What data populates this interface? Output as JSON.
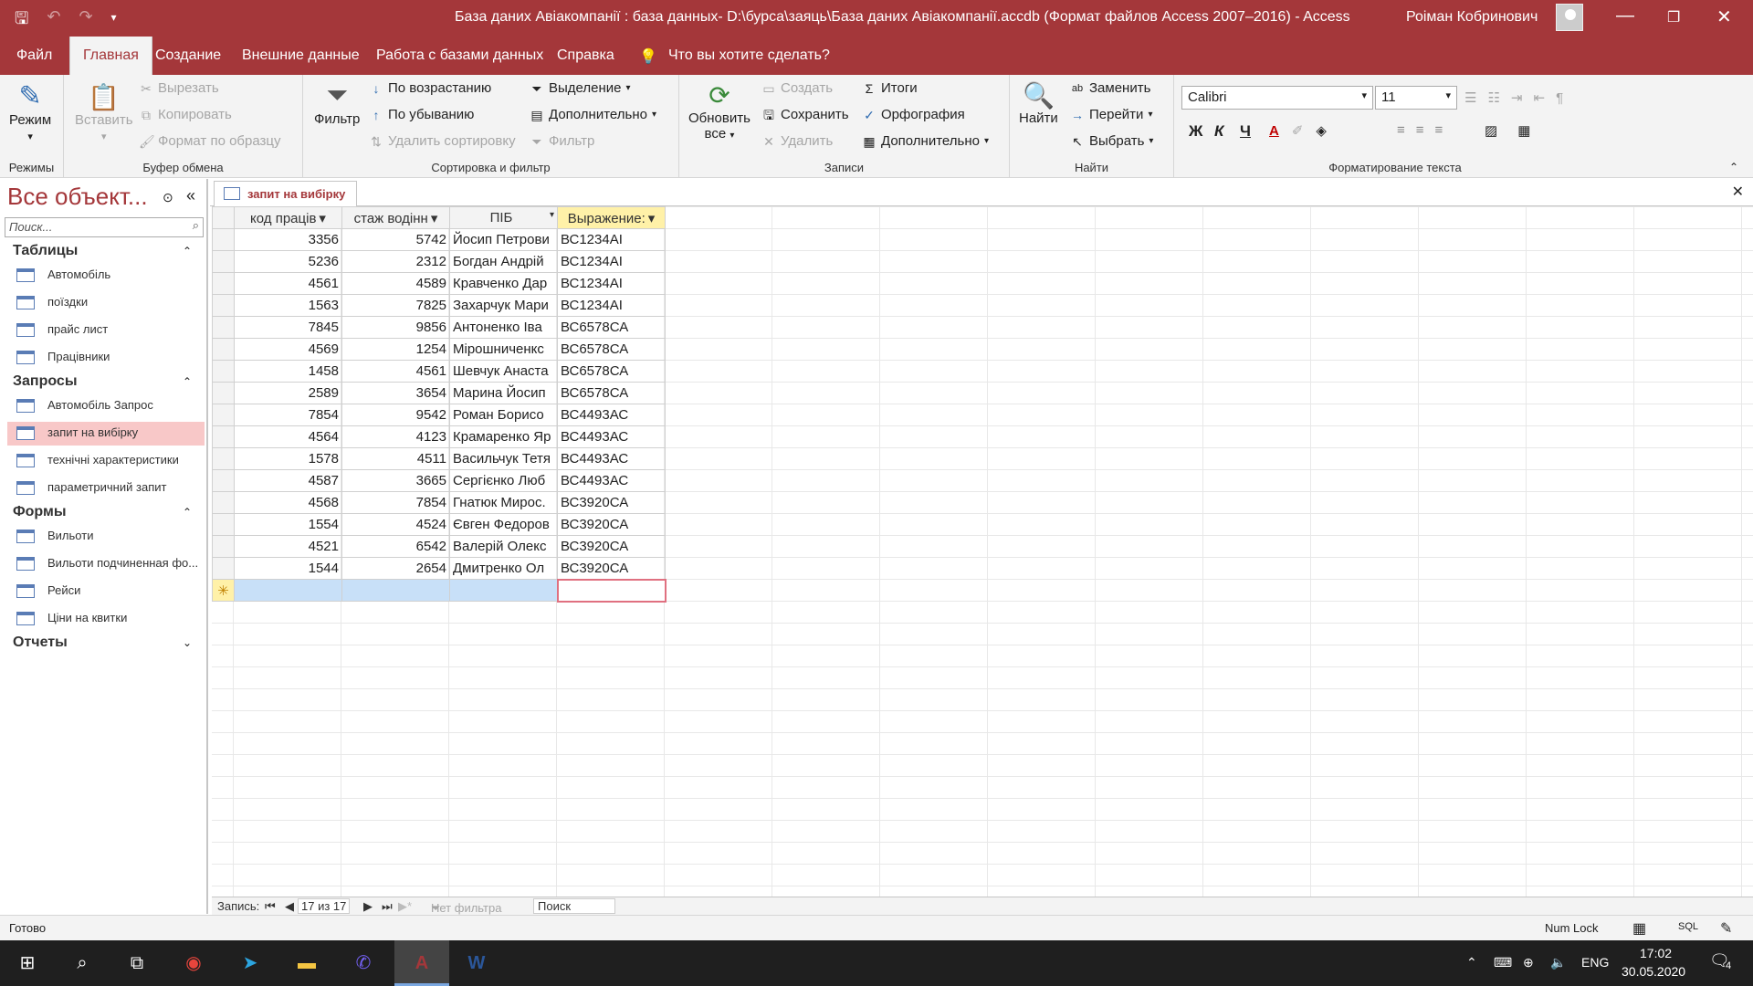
{
  "window": {
    "title": "База даних Авіакомпанії : база данных- D:\\бурса\\заяць\\База даних Авіакомпанії.accdb (Формат файлов Access 2007–2016)  -  Access",
    "user": "Роіман Кобринович"
  },
  "menu": {
    "file": "Файл",
    "home": "Главная",
    "create": "Создание",
    "external": "Внешние данные",
    "dbtools": "Работа с базами данных",
    "help": "Справка",
    "tellme": "Что вы хотите сделать?"
  },
  "ribbon": {
    "views": {
      "mode": "Режим",
      "label": "Режимы"
    },
    "clipboard": {
      "paste": "Вставить",
      "cut": "Вырезать",
      "copy": "Копировать",
      "format": "Формат по образцу",
      "label": "Буфер обмена"
    },
    "sort": {
      "filter": "Фильтр",
      "asc": "По возрастанию",
      "desc": "По убыванию",
      "remove": "Удалить сортировку",
      "selection": "Выделение",
      "advanced": "Дополнительно",
      "toggle": "Фильтр",
      "label": "Сортировка и фильтр"
    },
    "records": {
      "refresh1": "Обновить",
      "refresh2": "все",
      "new": "Создать",
      "save": "Сохранить",
      "delete": "Удалить",
      "totals": "Итоги",
      "spelling": "Орфография",
      "more": "Дополнительно",
      "label": "Записи"
    },
    "find": {
      "find": "Найти",
      "replace": "Заменить",
      "goto": "Перейти",
      "select": "Выбрать",
      "label": "Найти"
    },
    "text": {
      "font": "Calibri",
      "size": "11",
      "bold": "Ж",
      "italic": "К",
      "underline": "Ч",
      "label": "Форматирование текста"
    }
  },
  "nav": {
    "title": "Все объект...",
    "search_placeholder": "Поиск...",
    "sections": [
      {
        "name": "Таблицы",
        "items": [
          "Автомобіль",
          "поїздки",
          "прайс лист",
          "Працівники"
        ]
      },
      {
        "name": "Запросы",
        "items": [
          "Автомобіль Запрос",
          "запит на вибірку",
          "технічні характеристики",
          "параметричний запит"
        ]
      },
      {
        "name": "Формы",
        "items": [
          "Вильоти",
          "Вильоти подчиненная фо...",
          "Рейси",
          "Ціни на квитки"
        ]
      },
      {
        "name": "Отчеты",
        "items": []
      }
    ]
  },
  "doc_tab": "запит на вибірку",
  "table": {
    "headers": [
      "код  праців ▾",
      "стаж водінн ▾",
      "ПІБ",
      "Выражение: ▾"
    ],
    "rows": [
      [
        "3356",
        "5742",
        "Йосип Петрови",
        "ВС1234АІ"
      ],
      [
        "5236",
        "2312",
        "Богдан Андрій",
        "ВС1234АІ"
      ],
      [
        "4561",
        "4589",
        "Кравченко Дар",
        "ВС1234АІ"
      ],
      [
        "1563",
        "7825",
        "Захарчук Мари",
        "ВС1234АІ"
      ],
      [
        "7845",
        "9856",
        "Антоненко Іва",
        "ВС6578СА"
      ],
      [
        "4569",
        "1254",
        "Мірошниченкс",
        "ВС6578СА"
      ],
      [
        "1458",
        "4561",
        "Шевчук Анаста",
        "ВС6578СА"
      ],
      [
        "2589",
        "3654",
        "Марина Йосип",
        "ВС6578СА"
      ],
      [
        "7854",
        "9542",
        "Роман Борисо",
        "ВС4493АС"
      ],
      [
        "4564",
        "4123",
        "Крамаренко Яр",
        "ВС4493АС"
      ],
      [
        "1578",
        "4511",
        "Васильчук Тетя",
        "ВС4493АС"
      ],
      [
        "4587",
        "3665",
        "Сергієнко Люб",
        "ВС4493АС"
      ],
      [
        "4568",
        "7854",
        "Гнатюк Мирос.",
        "ВС3920СА"
      ],
      [
        "1554",
        "4524",
        "Євген Федоров",
        "ВС3920СА"
      ],
      [
        "4521",
        "6542",
        "Валерій Олекс",
        "ВС3920СА"
      ],
      [
        "1544",
        "2654",
        "Дмитренко Ол",
        "ВС3920СА"
      ]
    ]
  },
  "recnav": {
    "label": "Запись:",
    "pos": "17 из 17",
    "nofilter": "Нет фильтра",
    "search": "Поиск"
  },
  "status": {
    "ready": "Готово",
    "numlock": "Num Lock",
    "sql": "SQL"
  },
  "taskbar": {
    "lang": "ENG",
    "time": "17:02",
    "date": "30.05.2020",
    "notif": "4"
  }
}
